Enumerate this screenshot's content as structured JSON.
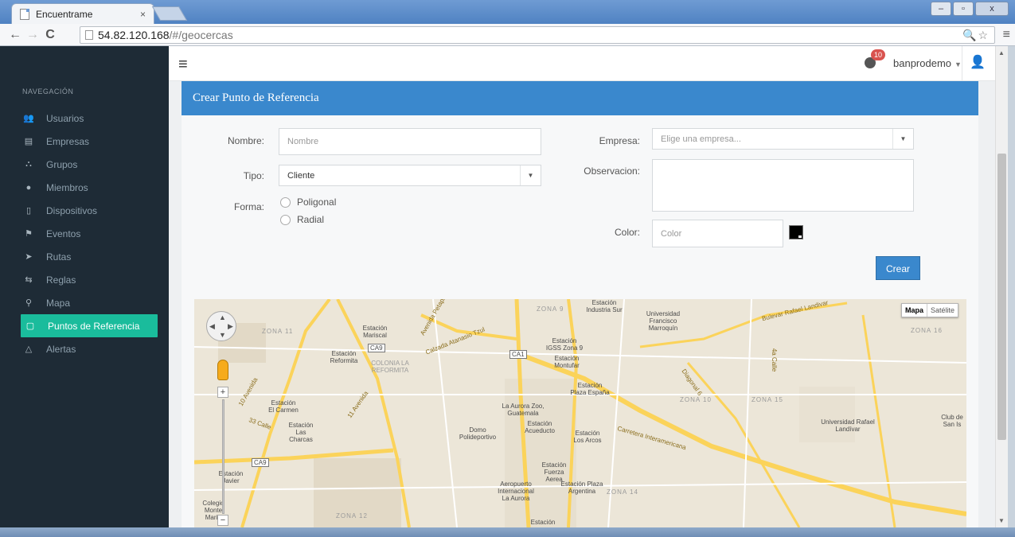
{
  "browser": {
    "tab_title": "Encuentrame",
    "tab_close": "×",
    "url_host": "54.82.120.168",
    "url_path": "/#/geocercas",
    "back": "←",
    "forward": "→",
    "reload": "C",
    "omni_right": "🔍☆",
    "menu": "≡",
    "win_min": "–",
    "win_max": "▫",
    "win_close": "x"
  },
  "topbar": {
    "hamburger": "≡",
    "notification_count": "10",
    "user_name": "banprodemo",
    "user_caret": "▼",
    "user_icon": "👤"
  },
  "sidebar": {
    "heading": "NAVEGACIÓN",
    "items": [
      {
        "label": "Usuarios",
        "icon": "👥"
      },
      {
        "label": "Empresas",
        "icon": "▤"
      },
      {
        "label": "Grupos",
        "icon": "⛬"
      },
      {
        "label": "Miembros",
        "icon": "●"
      },
      {
        "label": "Dispositivos",
        "icon": "▯"
      },
      {
        "label": "Eventos",
        "icon": "⚑"
      },
      {
        "label": "Rutas",
        "icon": "➤"
      },
      {
        "label": "Reglas",
        "icon": "⇆"
      },
      {
        "label": "Mapa",
        "icon": "⚲"
      },
      {
        "label": "Puntos de Referencia",
        "icon": "▢",
        "active": true
      },
      {
        "label": "Alertas",
        "icon": "△"
      }
    ]
  },
  "form": {
    "title": "Crear Punto de Referencia",
    "nombre_label": "Nombre:",
    "nombre_placeholder": "Nombre",
    "tipo_label": "Tipo:",
    "tipo_value": "Cliente",
    "forma_label": "Forma:",
    "forma_options": [
      "Poligonal",
      "Radial"
    ],
    "empresa_label": "Empresa:",
    "empresa_placeholder": "Elige una empresa...",
    "observacion_label": "Observacion:",
    "color_label": "Color:",
    "color_placeholder": "Color",
    "color_value": "#000000",
    "submit_label": "Crear",
    "select_caret": "▼"
  },
  "map": {
    "type_map": "Mapa",
    "type_satellite": "Satélite",
    "zoom_in": "+",
    "zoom_out": "−",
    "labels": {
      "zona11": "ZONA 11",
      "zona9": "ZONA 9",
      "zona10": "ZONA 10",
      "zona15": "ZONA 15",
      "zona16": "ZONA 16",
      "zona14": "ZONA 14",
      "zona12": "ZONA 12",
      "est_mariscal": "Estación Mariscal",
      "est_reformita": "Estación Reformita",
      "colonia": "COLONIA LA REFORMITA",
      "est_carmen": "Estación El Carmen",
      "est_charcas": "Estación Las Charcas",
      "est_javier": "Estación Javier",
      "colegio": "Colegio Monte María",
      "est_industria": "Estación Industria Sur",
      "est_igss": "Estación IGSS Zona 9",
      "est_montufar": "Estación Montufar",
      "est_plaza_espana": "Estación Plaza España",
      "aurora_zoo": "La Aurora Zoo, Guatemala",
      "domo": "Domo Polideportivo",
      "est_acueducto": "Estación Acueducto",
      "est_arcos": "Estación Los Arcos",
      "est_fuerza": "Estación Fuerza Aerea",
      "aeropuerto": "Aeropuerto Internacional La Aurora",
      "est_argentina": "Estación Plaza Argentina",
      "estacion_bottom": "Estación",
      "univ_marroquin": "Universidad Francisco Marroquín",
      "univ_landivar": "Universidad Rafael Landívar",
      "club": "Club de San Is",
      "carretera": "Carretera Interamericana",
      "bulevar": "Bulevar Rafael Landivar",
      "calzada": "Calzada Atanasio Tzul",
      "av_petapa": "Avenida Petapa",
      "av10": "10 Avenida",
      "av11": "11 Avenida",
      "calle33": "33 Calle",
      "diagonal": "Diagonal 6",
      "calle4a": "4a Calle",
      "ca9": "CA9",
      "ca1": "CA1"
    }
  }
}
